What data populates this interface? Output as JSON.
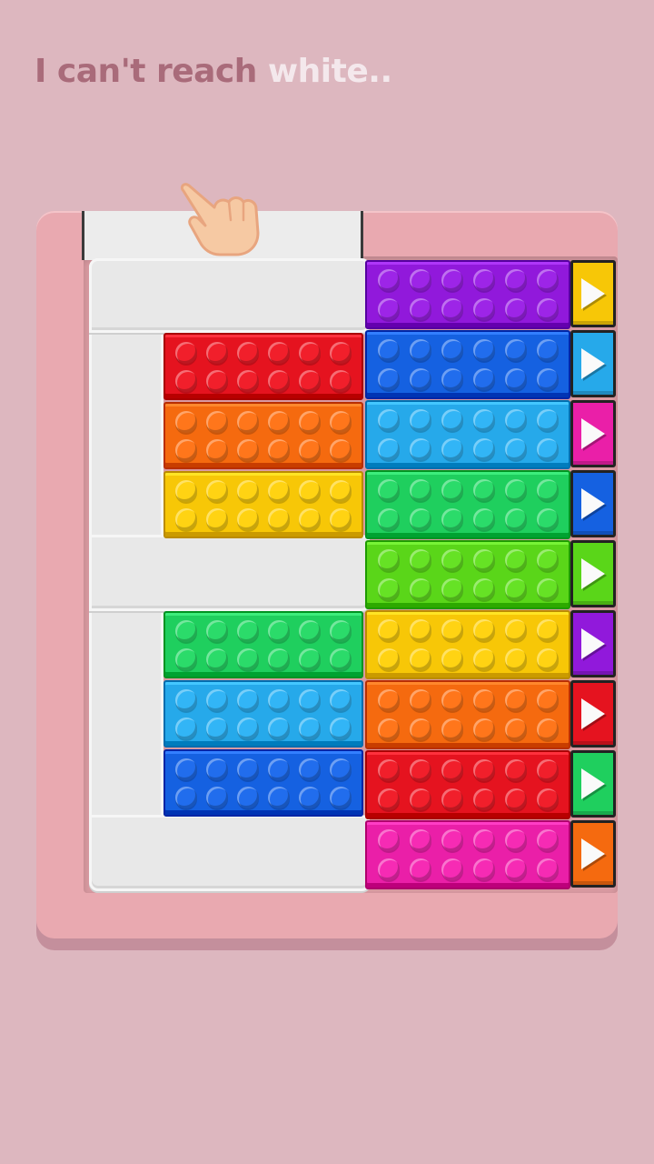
{
  "caption": {
    "part1": "I can't reach ",
    "part2": "white.."
  },
  "colors": {
    "background": "#ddb7bf",
    "caption_primary": "#a96b7a",
    "caption_highlight": "#f4e8ec",
    "board": "#e9a9b0",
    "white_piece": "#e8e8e8"
  },
  "left_blocks": [
    {
      "color": "red",
      "hex": "#e5131f"
    },
    {
      "color": "orange",
      "hex": "#f56a0f"
    },
    {
      "color": "yellow",
      "hex": "#f7c707"
    },
    {
      "color": "green",
      "hex": "#1fcf5e"
    },
    {
      "color": "light-blue",
      "hex": "#26a9ea"
    },
    {
      "color": "blue",
      "hex": "#1561e1"
    }
  ],
  "right_blocks": [
    {
      "color": "purple",
      "hex": "#9119db"
    },
    {
      "color": "blue",
      "hex": "#1561e1"
    },
    {
      "color": "light-blue",
      "hex": "#26a9ea"
    },
    {
      "color": "green",
      "hex": "#1fcf5e"
    },
    {
      "color": "lime",
      "hex": "#5ad619"
    },
    {
      "color": "yellow",
      "hex": "#f7c707"
    },
    {
      "color": "orange",
      "hex": "#f56a0f"
    },
    {
      "color": "red",
      "hex": "#e5131f"
    },
    {
      "color": "magenta",
      "hex": "#ea1fa8"
    }
  ],
  "arrow_tiles": [
    {
      "color": "yellow",
      "hex": "#f7c707",
      "icon": "arrow-right-icon"
    },
    {
      "color": "light-blue",
      "hex": "#26a9ea",
      "icon": "arrow-right-icon"
    },
    {
      "color": "magenta",
      "hex": "#ea1fa8",
      "icon": "arrow-right-icon"
    },
    {
      "color": "blue",
      "hex": "#1561e1",
      "icon": "arrow-right-icon"
    },
    {
      "color": "lime",
      "hex": "#5ad619",
      "icon": "arrow-right-icon"
    },
    {
      "color": "purple",
      "hex": "#9119db",
      "icon": "arrow-right-icon"
    },
    {
      "color": "red",
      "hex": "#e5131f",
      "icon": "arrow-right-icon"
    },
    {
      "color": "green",
      "hex": "#1fcf5e",
      "icon": "arrow-right-icon"
    },
    {
      "color": "orange",
      "hex": "#f56a0f",
      "icon": "arrow-right-icon"
    }
  ],
  "hand_icon": "pointing-hand-icon"
}
